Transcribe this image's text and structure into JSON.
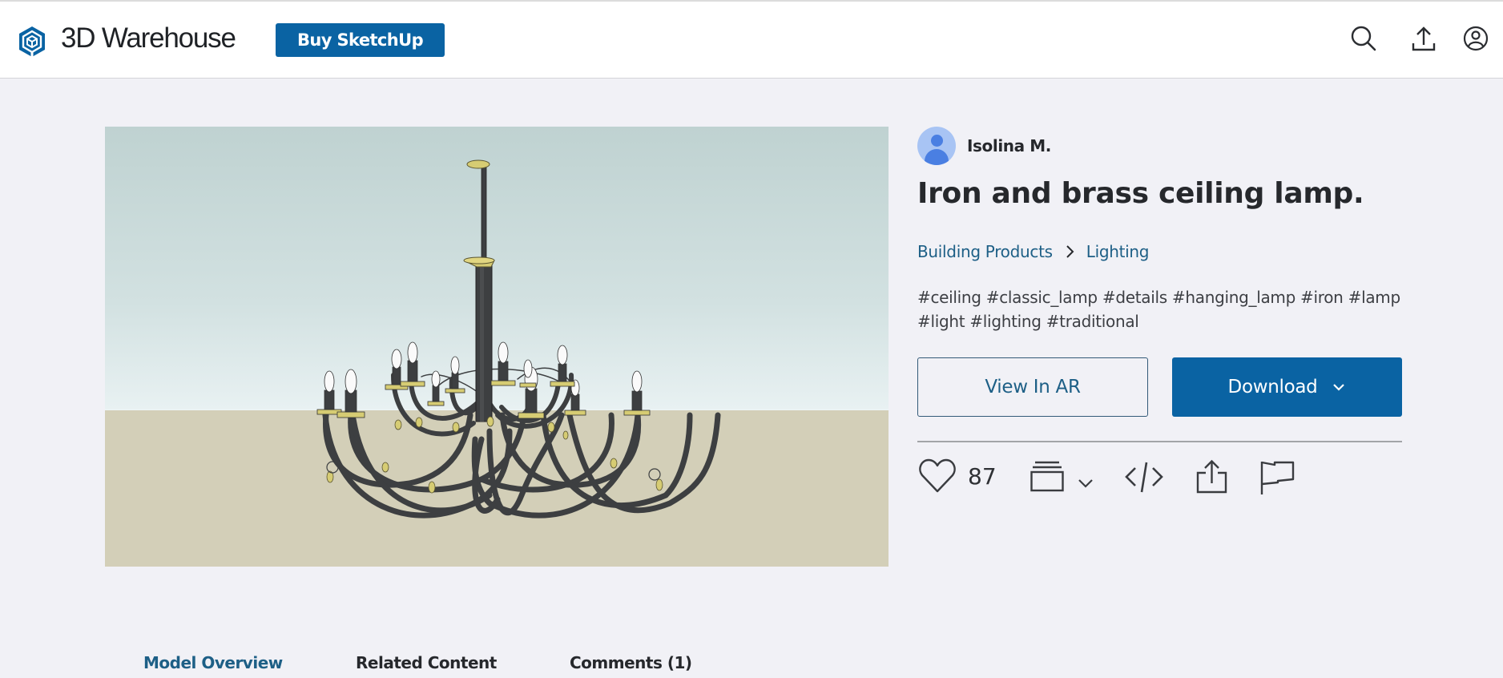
{
  "header": {
    "app_title": "3D Warehouse",
    "buy_button": "Buy SketchUp",
    "icons": [
      "logo-icon",
      "search-icon",
      "upload-icon",
      "user-account-icon"
    ],
    "brand_color": "#0a63a3"
  },
  "model": {
    "preview_alt": "Chandelier 3D model preview",
    "author": "Isolina M.",
    "title": "Iron and brass ceiling lamp.",
    "breadcrumb": [
      "Building Products",
      "Lighting"
    ],
    "tags_line1": "#ceiling #classic_lamp #details #hanging_lamp #iron #lamp",
    "tags_line2": "#light #lighting #traditional",
    "tags": [
      "#ceiling",
      "#classic_lamp",
      "#details",
      "#hanging_lamp",
      "#iron",
      "#lamp",
      "#light",
      "#lighting",
      "#traditional"
    ]
  },
  "actions": {
    "view_ar": "View In AR",
    "download": "Download",
    "likes": "87",
    "icons": [
      "heart-icon",
      "collection-icon",
      "chevron-down-icon",
      "embed-code-icon",
      "share-icon",
      "flag-icon"
    ]
  },
  "tabs": [
    {
      "label": "Model Overview",
      "active": true
    },
    {
      "label": "Related Content",
      "active": false
    },
    {
      "label": "Comments (1)",
      "active": false
    }
  ]
}
